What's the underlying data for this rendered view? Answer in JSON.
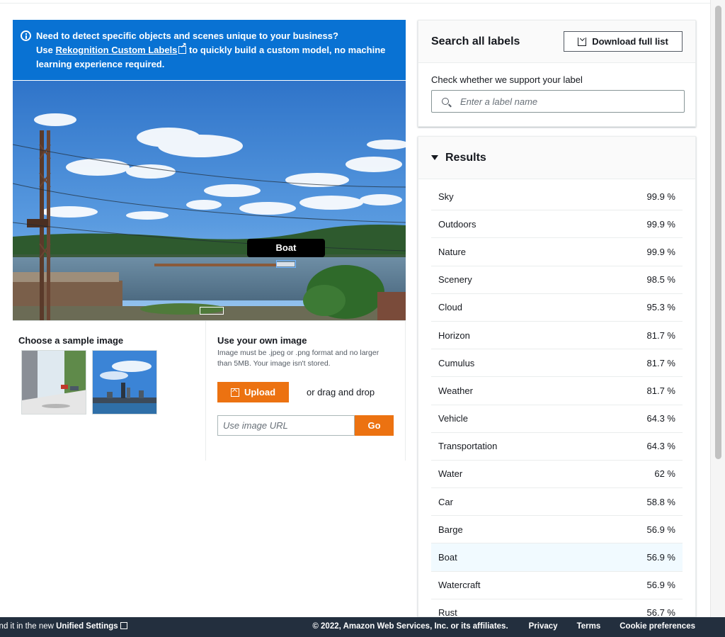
{
  "banner": {
    "line1": "Need to detect specific objects and scenes unique to your business?",
    "use_text": "Use",
    "link_text": "Rekognition Custom Labels",
    "line2_rest": "to quickly build a custom model, no machine",
    "line3": "learning experience required."
  },
  "image": {
    "tooltip": "Boat"
  },
  "sample": {
    "title": "Choose a sample image"
  },
  "own_image": {
    "title": "Use your own image",
    "hint": "Image must be .jpeg or .png format and no larger than 5MB. Your image isn't stored.",
    "upload_label": "Upload",
    "drag_text": "or drag and drop",
    "url_placeholder": "Use image URL",
    "go_label": "Go"
  },
  "search": {
    "title": "Search all labels",
    "download_label": "Download full list",
    "check_label": "Check whether we support your label",
    "placeholder": "Enter a label name"
  },
  "results": {
    "title": "Results",
    "items": [
      {
        "label": "Sky",
        "value": "99.9 %"
      },
      {
        "label": "Outdoors",
        "value": "99.9 %"
      },
      {
        "label": "Nature",
        "value": "99.9 %"
      },
      {
        "label": "Scenery",
        "value": "98.5 %"
      },
      {
        "label": "Cloud",
        "value": "95.3 %"
      },
      {
        "label": "Horizon",
        "value": "81.7 %"
      },
      {
        "label": "Cumulus",
        "value": "81.7 %"
      },
      {
        "label": "Weather",
        "value": "81.7 %"
      },
      {
        "label": "Vehicle",
        "value": "64.3 %"
      },
      {
        "label": "Transportation",
        "value": "64.3 %"
      },
      {
        "label": "Water",
        "value": "62 %"
      },
      {
        "label": "Car",
        "value": "58.8 %"
      },
      {
        "label": "Barge",
        "value": "56.9 %"
      },
      {
        "label": "Boat",
        "value": "56.9 %"
      },
      {
        "label": "Watercraft",
        "value": "56.9 %"
      },
      {
        "label": "Rust",
        "value": "56.7 %"
      }
    ]
  },
  "footer": {
    "left_prefix": "ind it in the new",
    "left_link": "Unified Settings",
    "copyright": "© 2022, Amazon Web Services, Inc. or its affiliates.",
    "privacy": "Privacy",
    "terms": "Terms",
    "cookies": "Cookie preferences"
  }
}
